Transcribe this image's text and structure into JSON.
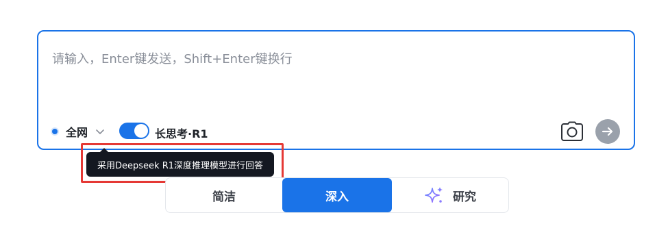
{
  "input": {
    "placeholder": "请输入，Enter键发送，Shift+Enter键换行",
    "value": ""
  },
  "scope": {
    "label": "全网"
  },
  "deep_think": {
    "enabled": true,
    "label": "长思考·R1"
  },
  "tooltip": {
    "text": "采用Deepseek R1深度推理模型进行回答"
  },
  "modes": {
    "items": [
      {
        "label": "简洁",
        "selected": false
      },
      {
        "label": "深入",
        "selected": true
      },
      {
        "label": "研究",
        "selected": false,
        "icon": "sparkle-icon"
      }
    ]
  },
  "colors": {
    "accent": "#1a73e8",
    "tooltip_bg": "#141821",
    "highlight": "#e53935",
    "send_disabled": "#9aa1ab"
  }
}
